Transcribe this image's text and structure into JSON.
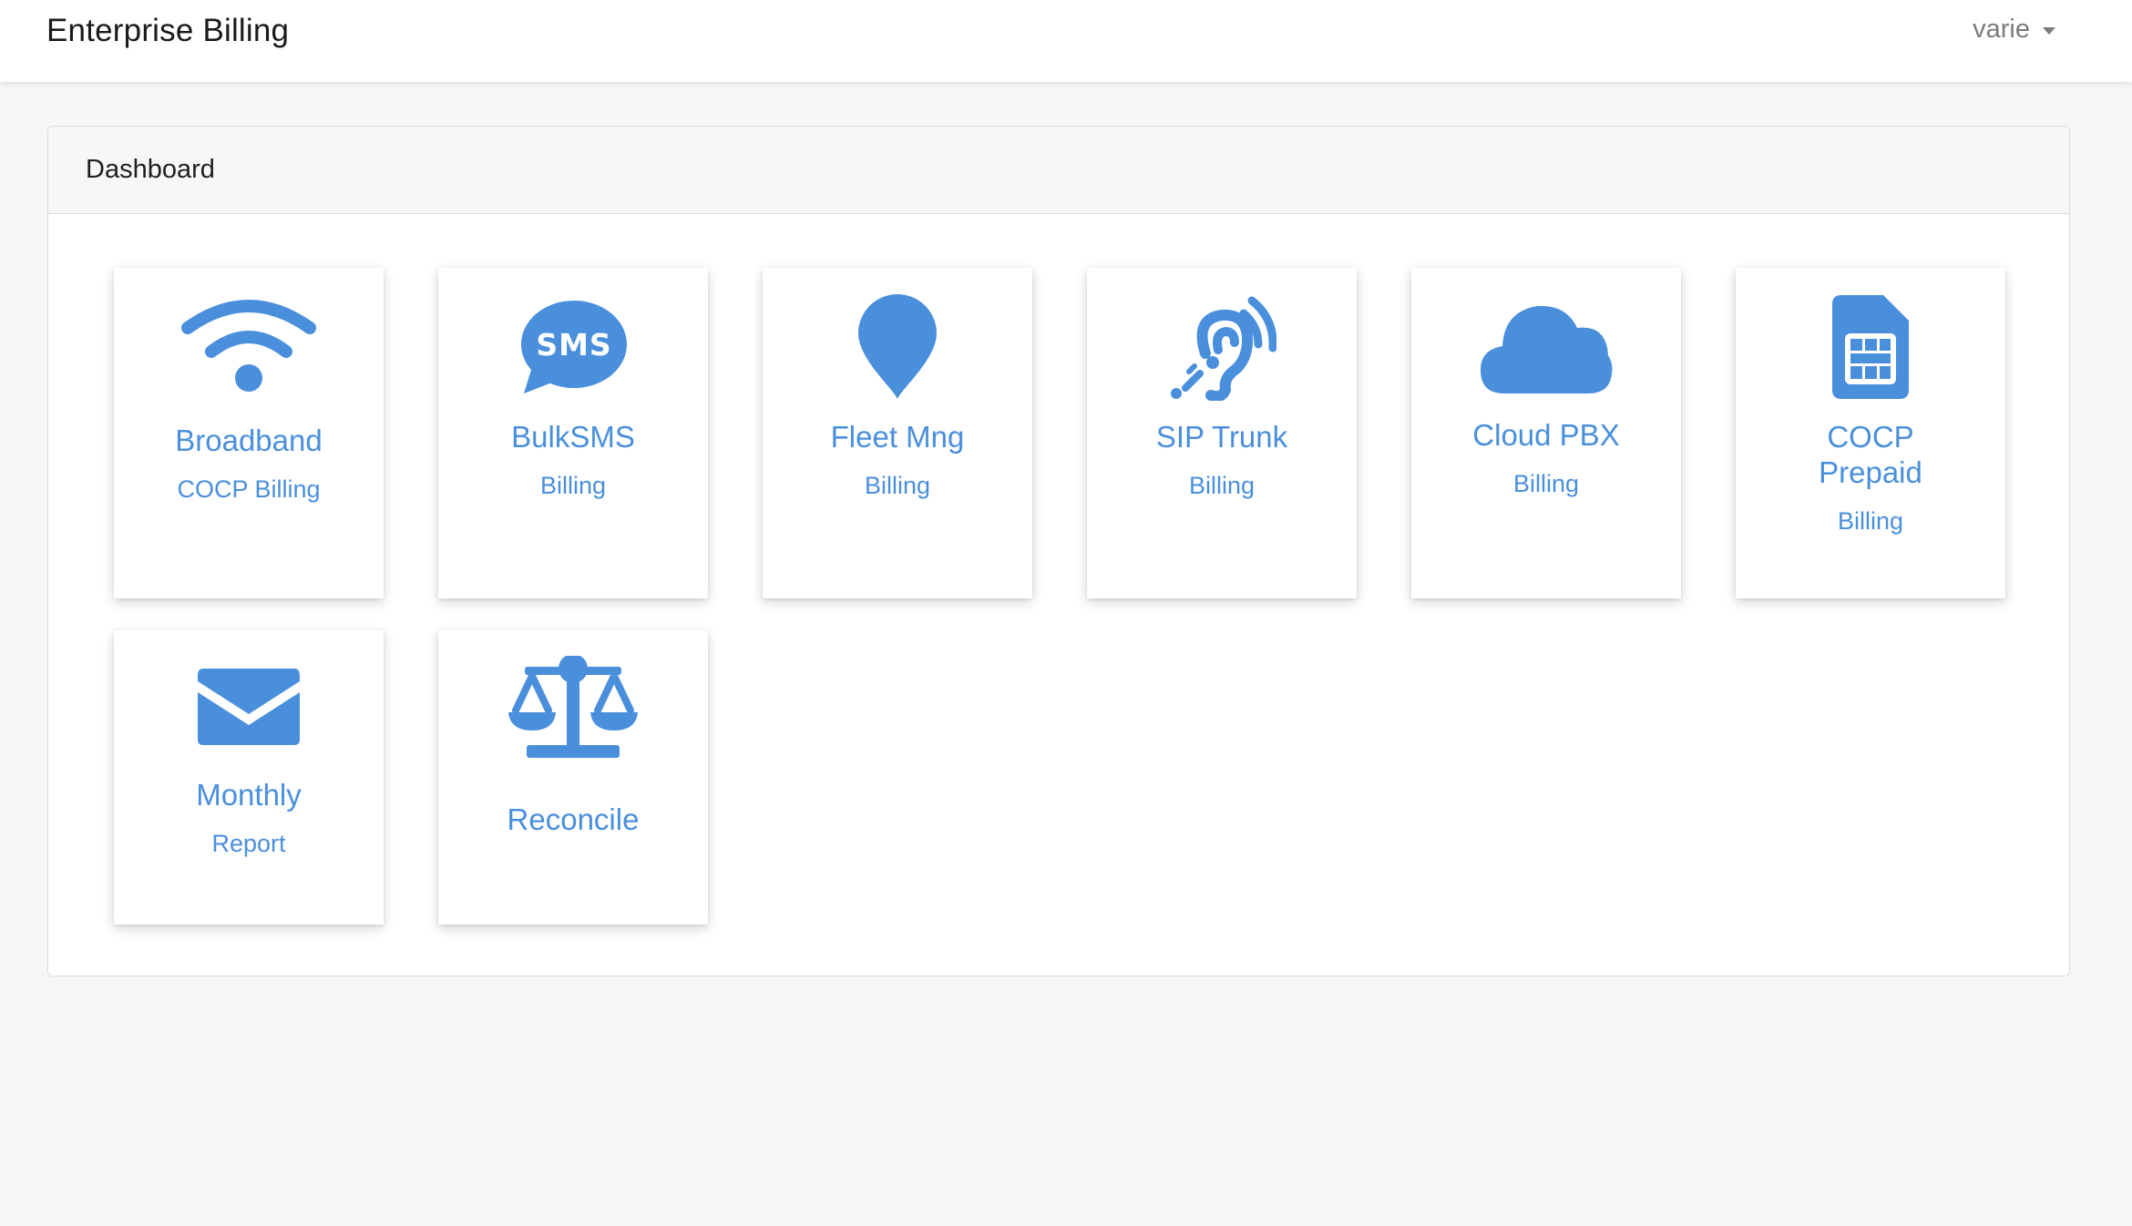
{
  "navbar": {
    "brand": "Enterprise Billing",
    "user": "varie"
  },
  "dashboard": {
    "title": "Dashboard",
    "tiles": [
      {
        "title": "Broadband",
        "subtitle": "COCP Billing",
        "icon": "wifi-icon"
      },
      {
        "title": "BulkSMS",
        "subtitle": "Billing",
        "icon": "sms-icon"
      },
      {
        "title": "Fleet Mng",
        "subtitle": "Billing",
        "icon": "map-marker-icon"
      },
      {
        "title": "SIP Trunk",
        "subtitle": "Billing",
        "icon": "assistive-listening-icon"
      },
      {
        "title": "Cloud PBX",
        "subtitle": "Billing",
        "icon": "cloud-icon"
      },
      {
        "title": "COCP Prepaid",
        "subtitle": "Billing",
        "icon": "sim-card-icon"
      },
      {
        "title": "Monthly",
        "subtitle": "Report",
        "icon": "envelope-icon"
      },
      {
        "title": "Reconcile",
        "subtitle": "",
        "icon": "balance-scale-icon"
      }
    ]
  },
  "colors": {
    "accent": "#4a8fdc",
    "background": "#f5f6f8"
  }
}
